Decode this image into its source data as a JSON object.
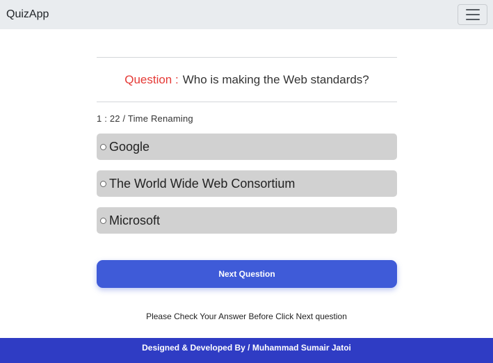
{
  "navbar": {
    "brand": "QuizApp",
    "menu_icon": "hamburger-menu-icon"
  },
  "quiz": {
    "question_label": "Question :",
    "question_text": "Who is making the Web standards?",
    "timer_text": "1 : 22 / Time Renaming",
    "options": [
      {
        "label": "Google"
      },
      {
        "label": "The World Wide Web Consortium"
      },
      {
        "label": "Microsoft"
      }
    ],
    "next_button_label": "Next Question",
    "note": "Please Check Your Answer Before Click Next question"
  },
  "footer": {
    "text": "Designed & Developed By / Muhammad Sumair Jatoi"
  },
  "colors": {
    "navbar_bg": "#e9ecef",
    "question_label": "#e53935",
    "option_bg": "#d1d1d1",
    "button_bg": "#3f5bd8",
    "footer_bg": "#2f3cc4"
  }
}
